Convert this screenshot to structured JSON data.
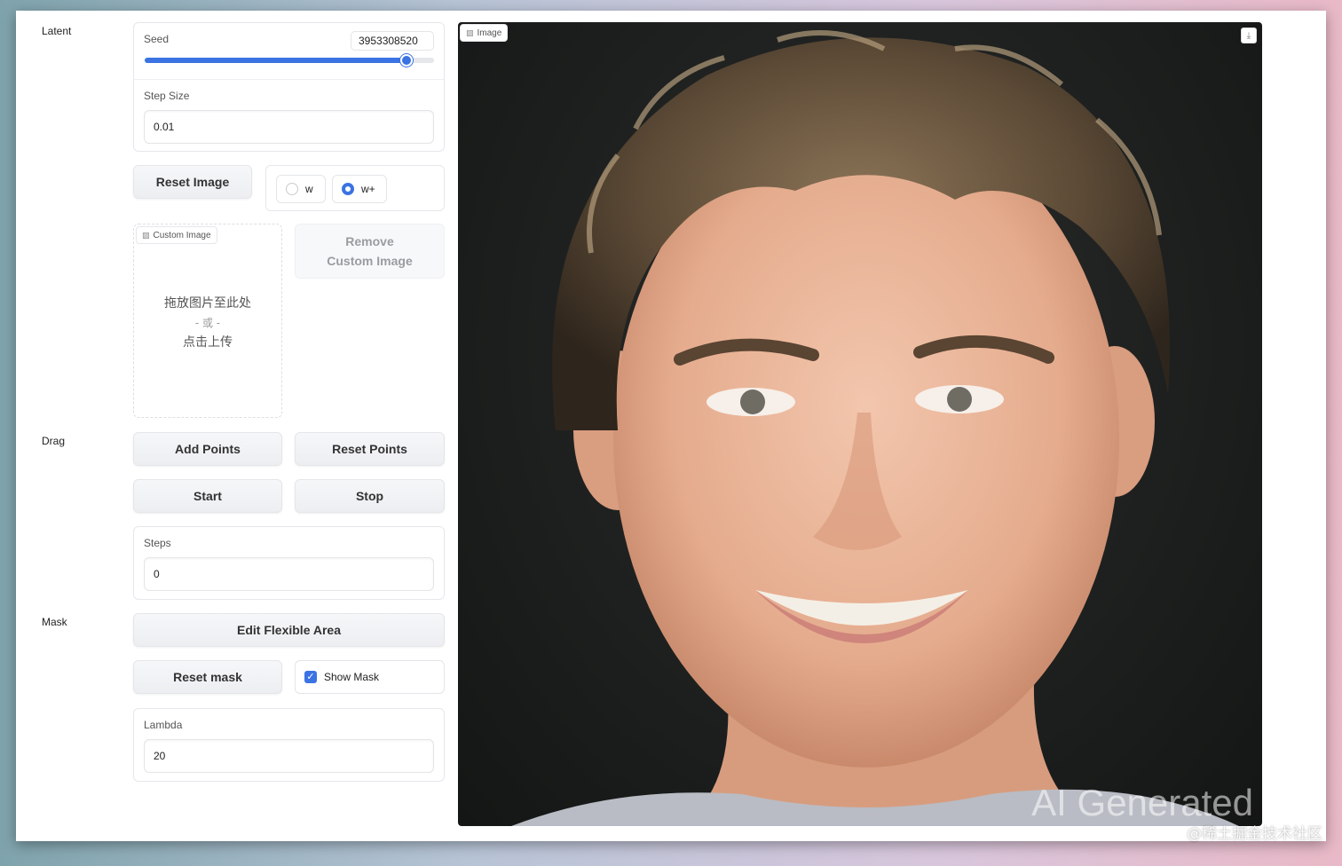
{
  "sections": {
    "latent": "Latent",
    "drag": "Drag",
    "mask": "Mask"
  },
  "seed": {
    "label": "Seed",
    "value": "3953308520",
    "slider_fraction": 0.905
  },
  "step_size": {
    "label": "Step Size",
    "value": "0.01"
  },
  "buttons": {
    "reset_image": "Reset Image",
    "remove_custom_image": "Remove Custom Image",
    "add_points": "Add Points",
    "reset_points": "Reset Points",
    "start": "Start",
    "stop": "Stop",
    "edit_flexible_area": "Edit Flexible Area",
    "reset_mask": "Reset mask"
  },
  "latent_space": {
    "options": [
      {
        "label": "w",
        "checked": false
      },
      {
        "label": "w+",
        "checked": true
      }
    ]
  },
  "custom_image": {
    "tag": "Custom Image",
    "drop_text": "拖放图片至此处",
    "or_text": "- 或 -",
    "click_text": "点击上传"
  },
  "steps": {
    "label": "Steps",
    "value": "0"
  },
  "show_mask": {
    "label": "Show Mask",
    "checked": true
  },
  "lambda": {
    "label": "Lambda",
    "value": "20"
  },
  "image": {
    "tag": "Image",
    "watermark": "AI Generated"
  },
  "credit": "@稀土掘金技术社区",
  "colors": {
    "accent": "#3b73e3"
  }
}
